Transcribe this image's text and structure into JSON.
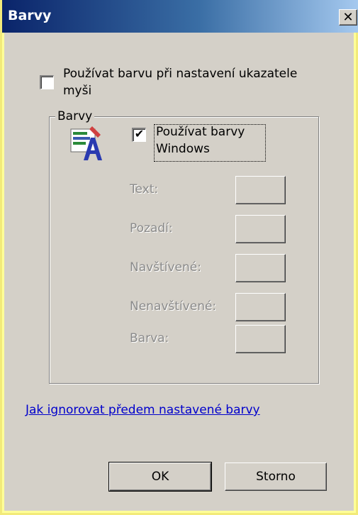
{
  "window": {
    "title": "Barvy",
    "close_glyph": "✕"
  },
  "mouse_pointer_option": {
    "label": "Používat barvu při nastavení ukazatele myši",
    "label_line1": "Používat barvu při nastavení ukazatele",
    "label_line2": "myši",
    "checked": false
  },
  "colors_group": {
    "legend": "Barvy",
    "icon": "colors-app-icon",
    "use_windows_colors": {
      "label_line1": "Používat barvy",
      "label_line2": "Windows",
      "checked": true,
      "check_glyph": "✔"
    },
    "rows": [
      {
        "label": "Text:"
      },
      {
        "label": "Pozadí:"
      },
      {
        "label": "Navštívené:"
      },
      {
        "label": "Nenavštívené:"
      },
      {
        "label": "Barva:"
      }
    ]
  },
  "help_link": "Jak ignorovat předem nastavené barvy",
  "buttons": {
    "ok": "OK",
    "cancel": "Storno"
  },
  "colors": {
    "titlebar_start": "#0a246a",
    "titlebar_end": "#a6caf0",
    "dialog_face": "#d4d0c8",
    "frame_highlight": "#ffff99",
    "link": "#0000cc",
    "disabled_text": "#8a8a8a"
  }
}
